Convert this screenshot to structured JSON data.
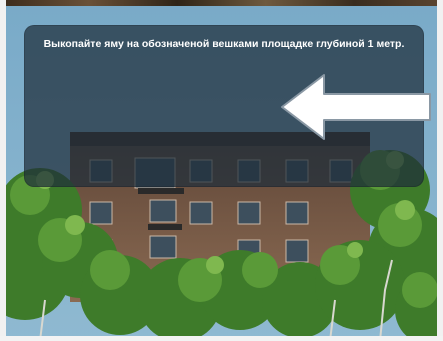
{
  "game": {
    "instruction_text": "Выкопайте яму на обозначеной вешками площадке глубиной 1 метр.",
    "icons": {
      "pointer": "arrow-left-icon"
    },
    "colors": {
      "sky": "#6f9fbe",
      "dialog_overlay": "#1e2e3a",
      "arrow_fill": "#ffffff",
      "arrow_border": "#7a8a96",
      "building": "#7b5b45",
      "foliage": "#3f7a2a"
    }
  }
}
